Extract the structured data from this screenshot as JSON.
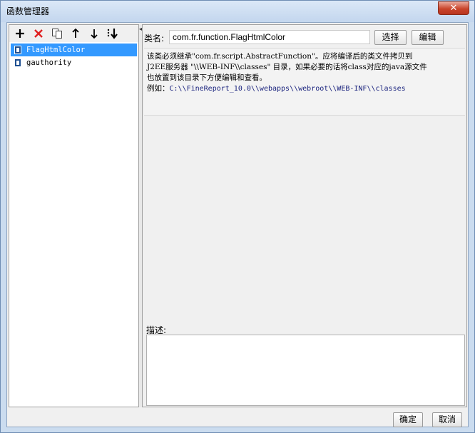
{
  "window": {
    "title": "函数管理器",
    "close_glyph": "✕"
  },
  "toolbar": {
    "add_icon": "add-icon",
    "delete_icon": "delete-icon",
    "copy_icon": "copy-icon",
    "move_up_icon": "arrow-up-icon",
    "move_down_icon": "arrow-down-icon",
    "sort_icon": "sort-icon"
  },
  "functions": [
    {
      "name": "FlagHtmlColor",
      "selected": true
    },
    {
      "name": "gauthority",
      "selected": false
    }
  ],
  "editor": {
    "class_label": "类名:",
    "class_value": "com.fr.function.FlagHtmlColor",
    "choose_label": "选择",
    "edit_label": "编辑",
    "info_line1": "该类必须继承\"com.fr.script.AbstractFunction\"。应将编译后的类文件拷贝到",
    "info_line2": "J2EE服务器 \"\\\\WEB-INF\\\\classes\" 目录，如果必要的话将class对应的java源文件",
    "info_line3": "也放置到该目录下方便编辑和查看。",
    "example_prefix": "例如：",
    "example_path": "C:\\\\FineReport_10.0\\\\webapps\\\\webroot\\\\WEB-INF\\\\classes",
    "desc_label": "描述:",
    "desc_value": ""
  },
  "footer": {
    "ok_label": "确定",
    "cancel_label": "取消"
  },
  "colors": {
    "selection": "#3399ff",
    "close_button": "#c9452b",
    "title_bar": "#cbdcef"
  }
}
